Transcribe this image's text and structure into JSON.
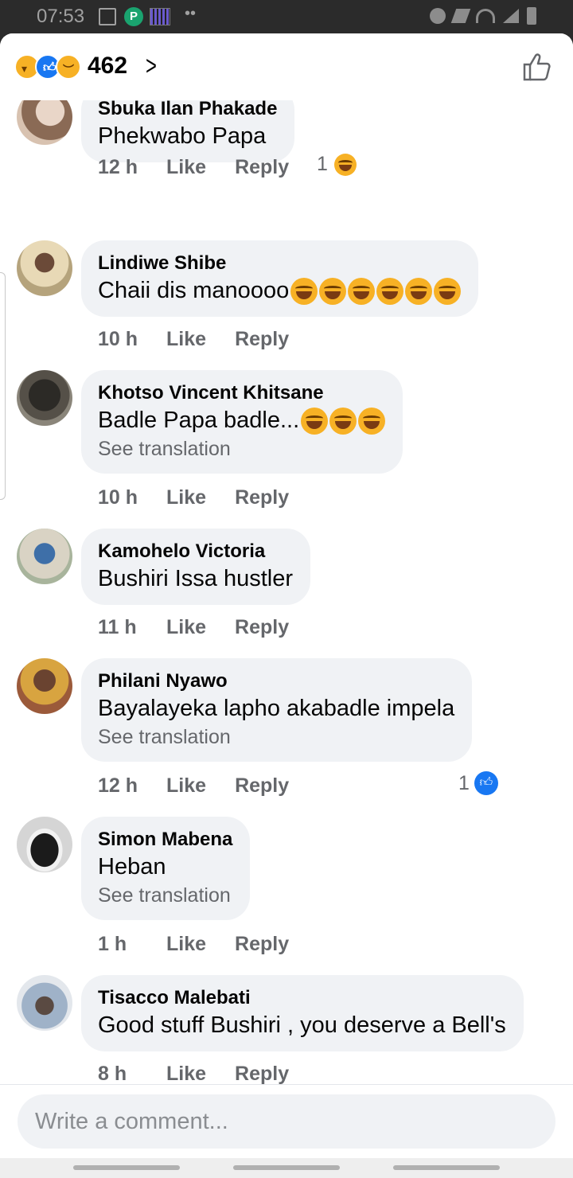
{
  "status_bar": {
    "time": "07:53"
  },
  "header": {
    "reaction_count": "462"
  },
  "comments": [
    {
      "author": "Sbuka Ilan Phakade",
      "text": "Phekwabo Papa",
      "time": "12 h",
      "like": "Like",
      "reply": "Reply",
      "reactions": "1"
    },
    {
      "author": "Lindiwe Shibe",
      "text": "Chaii dis manoooo",
      "time": "10 h",
      "like": "Like",
      "reply": "Reply"
    },
    {
      "author": "Khotso Vincent Khitsane",
      "text": "Badle Papa badle...",
      "translate": "See translation",
      "time": "10 h",
      "like": "Like",
      "reply": "Reply"
    },
    {
      "author": "Kamohelo Victoria",
      "text": "Bushiri Issa hustler",
      "time": "11 h",
      "like": "Like",
      "reply": "Reply"
    },
    {
      "author": "Philani Nyawo",
      "text": "Bayalayeka lapho akabadle impela",
      "translate": "See translation",
      "time": "12 h",
      "like": "Like",
      "reply": "Reply",
      "reactions": "1"
    },
    {
      "author": "Simon Mabena",
      "text": "Heban",
      "translate": "See translation",
      "time": "1 h",
      "like": "Like",
      "reply": "Reply"
    },
    {
      "author": "Tisacco Malebati",
      "text": "Good stuff Bushiri , you deserve a Bell's",
      "time": "8 h",
      "like": "Like",
      "reply": "Reply"
    }
  ],
  "composer": {
    "placeholder": "Write a comment..."
  },
  "colors": {
    "bubble": "#f0f2f5",
    "meta": "#65676b",
    "like_blue": "#1877f2",
    "haha_yellow": "#f7b125"
  }
}
